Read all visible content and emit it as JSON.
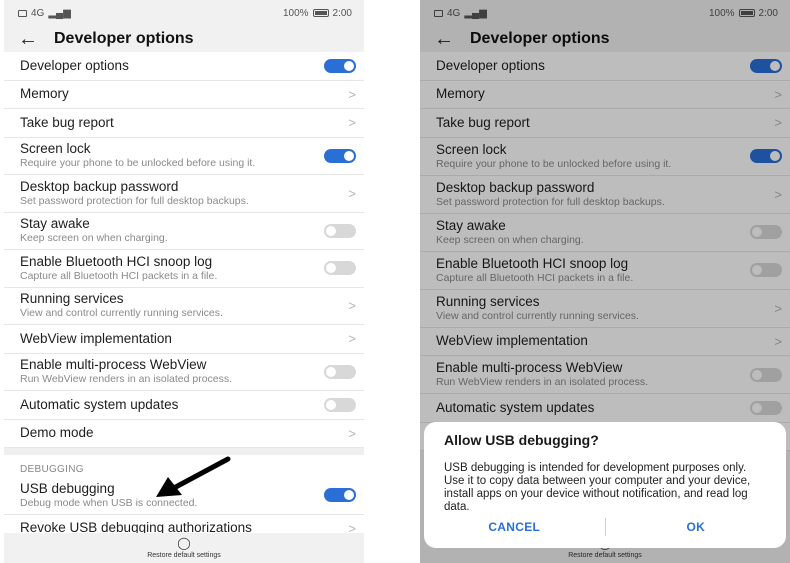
{
  "status_bar": {
    "signal": "4G",
    "battery": "100%",
    "time": "2:00"
  },
  "page_title": "Developer options",
  "rows": [
    {
      "title": "Developer options",
      "control": "toggle-on"
    },
    {
      "title": "Memory",
      "control": "chevron"
    },
    {
      "title": "Take bug report",
      "control": "chevron"
    },
    {
      "title": "Screen lock",
      "subtitle": "Require your phone to be unlocked before using it.",
      "control": "toggle-on"
    },
    {
      "title": "Desktop backup password",
      "subtitle": "Set password protection for full desktop backups.",
      "control": "chevron"
    },
    {
      "title": "Stay awake",
      "subtitle": "Keep screen on when charging.",
      "control": "toggle-off"
    },
    {
      "title": "Enable Bluetooth HCI snoop log",
      "subtitle": "Capture all Bluetooth HCI packets in a file.",
      "control": "toggle-off"
    },
    {
      "title": "Running services",
      "subtitle": "View and control currently running services.",
      "control": "chevron"
    },
    {
      "title": "WebView implementation",
      "control": "chevron"
    },
    {
      "title": "Enable multi-process WebView",
      "subtitle": "Run WebView renders in an isolated process.",
      "control": "toggle-off"
    },
    {
      "title": "Automatic system updates",
      "control": "toggle-off"
    },
    {
      "title": "Demo mode",
      "control": "chevron"
    }
  ],
  "debugging": {
    "header": "DEBUGGING",
    "rows": [
      {
        "title": "USB debugging",
        "subtitle": "Debug mode when USB is connected.",
        "control": "toggle-on"
      },
      {
        "title": "Revoke USB debugging authorizations",
        "control": "chevron"
      }
    ]
  },
  "restore_default": "Restore default settings",
  "chevron_glyph": ">",
  "dialog": {
    "title": "Allow USB debugging?",
    "body": "USB debugging is intended for development purposes only. Use it to copy data between your computer and your device, install apps on your device without notification, and read log data.",
    "cancel": "CANCEL",
    "ok": "OK"
  },
  "colors": {
    "accent": "#2a6fd6",
    "toggle_off": "#d8d8d8",
    "background": "#f1f1f1"
  },
  "icons": [
    "back-arrow-icon",
    "chevron-right-icon",
    "restore-icon",
    "annotation-arrow-icon"
  ]
}
